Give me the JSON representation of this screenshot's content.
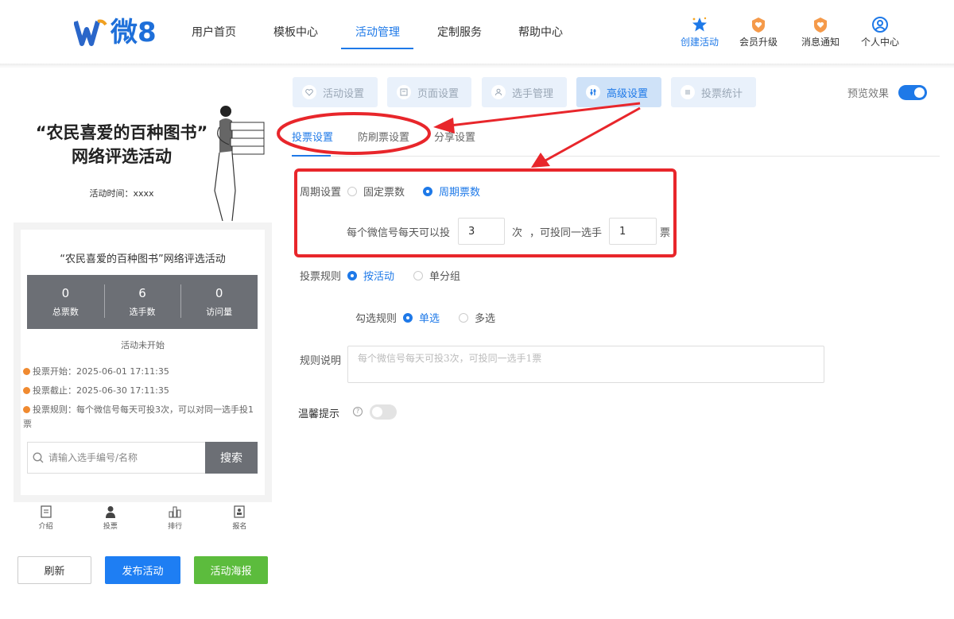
{
  "brand": {
    "logo_text": "微8"
  },
  "nav": {
    "items": [
      "用户首页",
      "模板中心",
      "活动管理",
      "定制服务",
      "帮助中心"
    ],
    "active_index": 2
  },
  "header_actions": [
    {
      "label": "创建活动",
      "icon": "star-icon"
    },
    {
      "label": "会员升级",
      "icon": "heart-badge-icon"
    },
    {
      "label": "消息通知",
      "icon": "heart-badge-icon"
    },
    {
      "label": "个人中心",
      "icon": "user-circle-icon"
    }
  ],
  "preview": {
    "poster_title_line1": "“农民喜爱的百种图书”",
    "poster_title_line2": "网络评选活动",
    "poster_time": "活动时间：xxxx",
    "card_title": "“农民喜爱的百种图书”网络评选活动",
    "stats": [
      {
        "value": "0",
        "label": "总票数"
      },
      {
        "value": "6",
        "label": "选手数"
      },
      {
        "value": "0",
        "label": "访问量"
      }
    ],
    "status": "活动未开始",
    "vote_start": "投票开始：2025-06-01 17:11:35",
    "vote_end": "投票截止：2025-06-30 17:11:35",
    "vote_rule": "投票规则：每个微信号每天可投3次，可以对同一选手投1票",
    "search_placeholder": "请输入选手编号/名称",
    "search_button": "搜索",
    "tabbar": [
      {
        "label": "介绍",
        "icon": "document-icon"
      },
      {
        "label": "投票",
        "icon": "person-icon"
      },
      {
        "label": "排行",
        "icon": "ranking-icon"
      },
      {
        "label": "报名",
        "icon": "signup-icon"
      }
    ]
  },
  "actions": {
    "refresh": "刷新",
    "publish": "发布活动",
    "poster": "活动海报"
  },
  "colors": {
    "primary": "#1e79e8",
    "publish": "#1e7ef3",
    "poster": "#5cbc3d",
    "annotation": "#e8262b"
  },
  "steps": [
    {
      "label": "活动设置",
      "icon": "heart-icon"
    },
    {
      "label": "页面设置",
      "icon": "page-icon"
    },
    {
      "label": "选手管理",
      "icon": "person-icon"
    },
    {
      "label": "高级设置",
      "icon": "sliders-icon",
      "active": true
    },
    {
      "label": "投票统计",
      "icon": "list-icon"
    }
  ],
  "preview_toggle": {
    "label": "预览效果",
    "on": true
  },
  "subtabs": [
    "投票设置",
    "防刷票设置",
    "分享设置"
  ],
  "form": {
    "period_label": "周期设置",
    "period_options": [
      "固定票数",
      "周期票数"
    ],
    "period_selected": 1,
    "per_day_prefix": "每个微信号每天可以投",
    "per_day_value": "3",
    "per_day_unit": "次",
    "same_player_prefix": "，可投同一选手",
    "same_player_value": "1",
    "same_player_unit": "票",
    "rule_label": "投票规则",
    "rule_options": [
      "按活动",
      "单分组"
    ],
    "rule_selected": 0,
    "check_label": "勾选规则",
    "check_options": [
      "单选",
      "多选"
    ],
    "check_selected": 0,
    "desc_label": "规则说明",
    "desc_placeholder": "每个微信号每天可投3次，可投同一选手1票",
    "tip_label": "温馨提示",
    "tip_on": false
  }
}
